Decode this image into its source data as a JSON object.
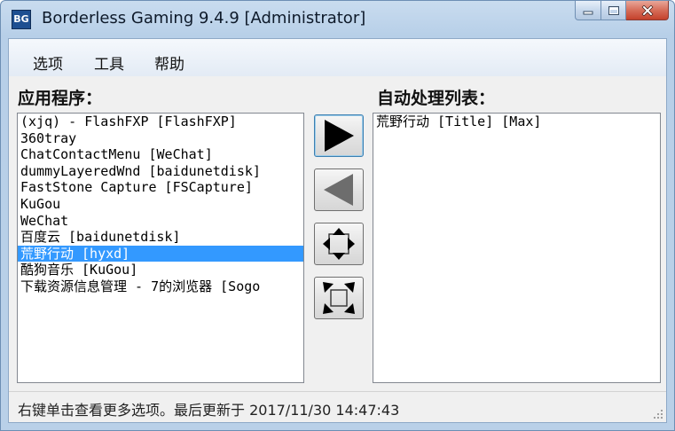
{
  "window": {
    "icon_text": "BG",
    "title": "Borderless Gaming 9.4.9 [Administrator]"
  },
  "menu": {
    "items": [
      "选项",
      "工具",
      "帮助"
    ]
  },
  "apps_panel": {
    "label": "应用程序：",
    "items": [
      "(xjq) - FlashFXP [FlashFXP]",
      "360tray",
      "ChatContactMenu [WeChat]",
      "dummyLayeredWnd [baidunetdisk]",
      "FastStone Capture [FSCapture]",
      "KuGou",
      "WeChat",
      "百度云 [baidunetdisk]",
      "荒野行动 [hyxd]",
      "酷狗音乐 [KuGou]",
      "下载资源信息管理 - 7的浏览器 [Sogo"
    ],
    "selected_index": 8
  },
  "favorites_panel": {
    "label": "自动处理列表：",
    "items": [
      "荒野行动 [Title] [Max]"
    ]
  },
  "icons": {
    "add": "arrow-right-icon",
    "remove": "arrow-left-icon",
    "make_borderless": "expand-arrows-icon",
    "restore": "collapse-arrows-icon"
  },
  "colors": {
    "selection": "#3399ff",
    "close_button": "#c4412c",
    "arrow_active": "#000000",
    "arrow_inactive": "#6d6d6d"
  },
  "status": {
    "text": "右键单击查看更多选项。最后更新于 2017/11/30 14:47:43"
  }
}
